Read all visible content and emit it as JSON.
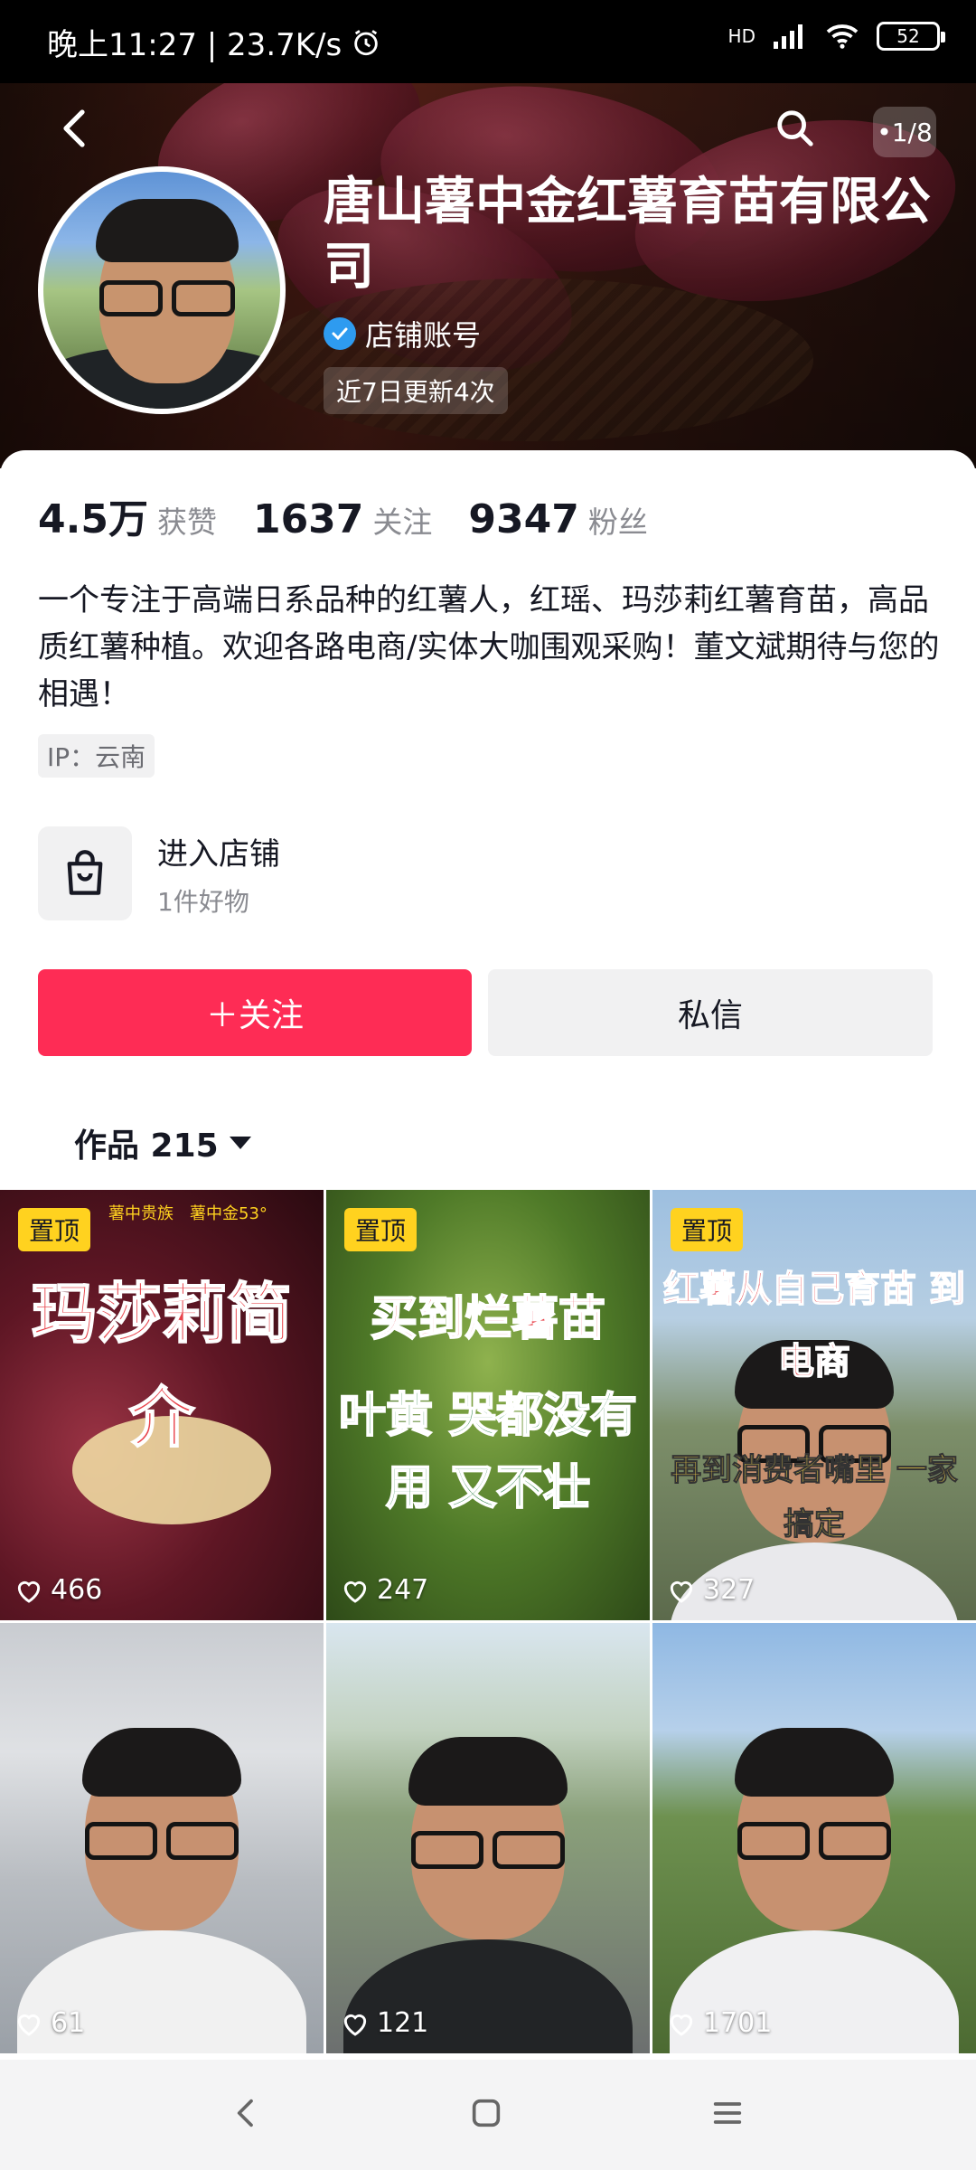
{
  "status_bar": {
    "left_text": "晚上11:27 | 23.7K/s",
    "network": "HD",
    "battery": "52"
  },
  "header": {
    "page_indicator": "•1/8",
    "store_name": "唐山薯中金红薯育苗有限公司",
    "account_type": "店铺账号",
    "update_text": "近7日更新4次"
  },
  "stats": [
    {
      "value": "4.5万",
      "label": "获赞"
    },
    {
      "value": "1637",
      "label": "关注"
    },
    {
      "value": "9347",
      "label": "粉丝"
    }
  ],
  "bio": "一个专注于高端日系品种的红薯人，红瑶、玛莎莉红薯育苗，高品质红薯种植。欢迎各路电商/实体大咖围观采购！董文斌期待与您的相遇！",
  "ip": "IP：云南",
  "shop": {
    "title": "进入店铺",
    "subtitle": "1件好物"
  },
  "actions": {
    "follow": "＋关注",
    "message": "私信"
  },
  "works": {
    "label": "作品 215"
  },
  "videos": [
    {
      "pinned": "置顶",
      "title": "玛莎莉简介",
      "likes": "466",
      "top_caption": "薯中贵族　薯中金53°"
    },
    {
      "pinned": "置顶",
      "title": "买到烂薯苗",
      "subtitle": "叶黄 哭都没有用 又不壮",
      "likes": "247"
    },
    {
      "pinned": "置顶",
      "title": "红薯从自己育苗 到电商",
      "subtitle": "再到消费者嘴里 一家搞定",
      "likes": "327"
    },
    {
      "likes": "61"
    },
    {
      "likes": "121"
    },
    {
      "likes": "1701"
    }
  ],
  "colors": {
    "accent": "#fe2c55",
    "pin_yellow": "#ffd21f",
    "verified_blue": "#2e9bf0"
  },
  "icons": {
    "back": "chevron-left-icon",
    "search": "search-icon",
    "shop": "shopping-bag-icon",
    "like": "heart-icon",
    "nav_back": "nav-back-icon",
    "nav_home": "nav-home-icon",
    "nav_menu": "nav-menu-icon"
  }
}
